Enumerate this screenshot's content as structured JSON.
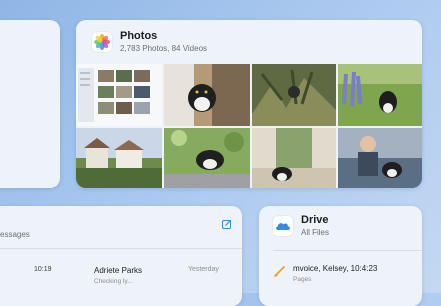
{
  "photos": {
    "title": "Photos",
    "subtitle": "2,783 Photos, 84 Videos"
  },
  "messages": {
    "header": "essages",
    "row": {
      "time": "10:19",
      "name": "Adriete Parks",
      "preview": "Checking ly...",
      "date": "Yesterday"
    }
  },
  "drive": {
    "title": "Drive",
    "subtitle": "All Files",
    "file": {
      "name": "mvoice, Kelsey, 10:4:23",
      "app": "Pages"
    }
  },
  "colors": {
    "background": "#a9c8ef",
    "card": "#eef3fa",
    "drive_accent": "#2e8bea",
    "pages_accent": "#f09a1a",
    "compose_accent": "#2e8bea"
  },
  "icons": {
    "photos_app": "photos-pinwheel-icon",
    "drive_app": "icloud-drive-icon",
    "compose": "compose-icon",
    "pages_doc": "pages-icon"
  }
}
